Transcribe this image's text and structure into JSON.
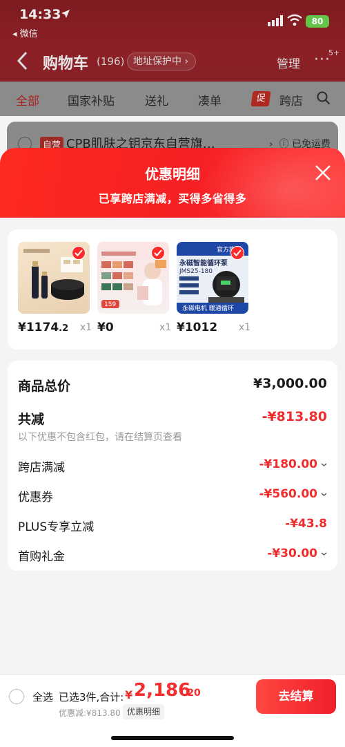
{
  "status_bar": {
    "time": "14:33",
    "back_app": "◂ 微信",
    "battery": "80"
  },
  "nav": {
    "title": "购物车",
    "count": "(196)",
    "address_badge": "地址保护中",
    "manage": "管理",
    "more_badge": "5+"
  },
  "tabs": [
    "全部",
    "国家补贴",
    "送礼",
    "凑单",
    "跨店"
  ],
  "promo_tag": "促",
  "store": {
    "self_operated": "自营",
    "name": "CPB肌肤之钥京东自营旗…",
    "shipping": "已免运费"
  },
  "sheet": {
    "title": "优惠明细",
    "subtitle": "已享跨店满减，买得多省得多"
  },
  "products": [
    {
      "price_int": "¥1174",
      "price_dec": ".2",
      "qty": "x1",
      "image": "cosmetics-product-image"
    },
    {
      "price_int": "¥0",
      "price_dec": "",
      "qty": "x1",
      "image": "facial-mask-sample-image",
      "image_text": "159"
    },
    {
      "price_int": "¥1012",
      "price_dec": "",
      "qty": "x1",
      "image": "circulation-pump-image",
      "image_text": "永磁智能循环泵",
      "image_badge": "官方旗舰",
      "image_model": "JMS25-180",
      "image_footer": "永磁电机 暖通循环"
    }
  ],
  "summary": {
    "total_label": "商品总价",
    "total_value": "¥3,000.00",
    "reduction_label": "共减",
    "reduction_value": "-¥813.80",
    "note": "以下优惠不包含红包，请在结算页查看",
    "items": [
      {
        "label": "跨店满减",
        "value": "-¥180.00",
        "chevron": true
      },
      {
        "label": "优惠券",
        "value": "-¥560.00",
        "chevron": true
      },
      {
        "label": "PLUS专享立减",
        "value": "-¥43.8",
        "chevron": false
      },
      {
        "label": "首购礼金",
        "value": "-¥30.00",
        "chevron": true
      }
    ]
  },
  "bottom": {
    "select_all": "全选",
    "selected": "已选3件,合计:",
    "currency": "¥",
    "total_int": "2,186",
    "total_dec": ".20",
    "discount": "优惠减:¥813.80",
    "discount_detail": "优惠明细",
    "checkout": "去结算"
  },
  "colors": {
    "accent": "#ef2d2d",
    "header_gradient_start": "#ff2a1f",
    "header_gradient_end": "#ff3b3b"
  }
}
